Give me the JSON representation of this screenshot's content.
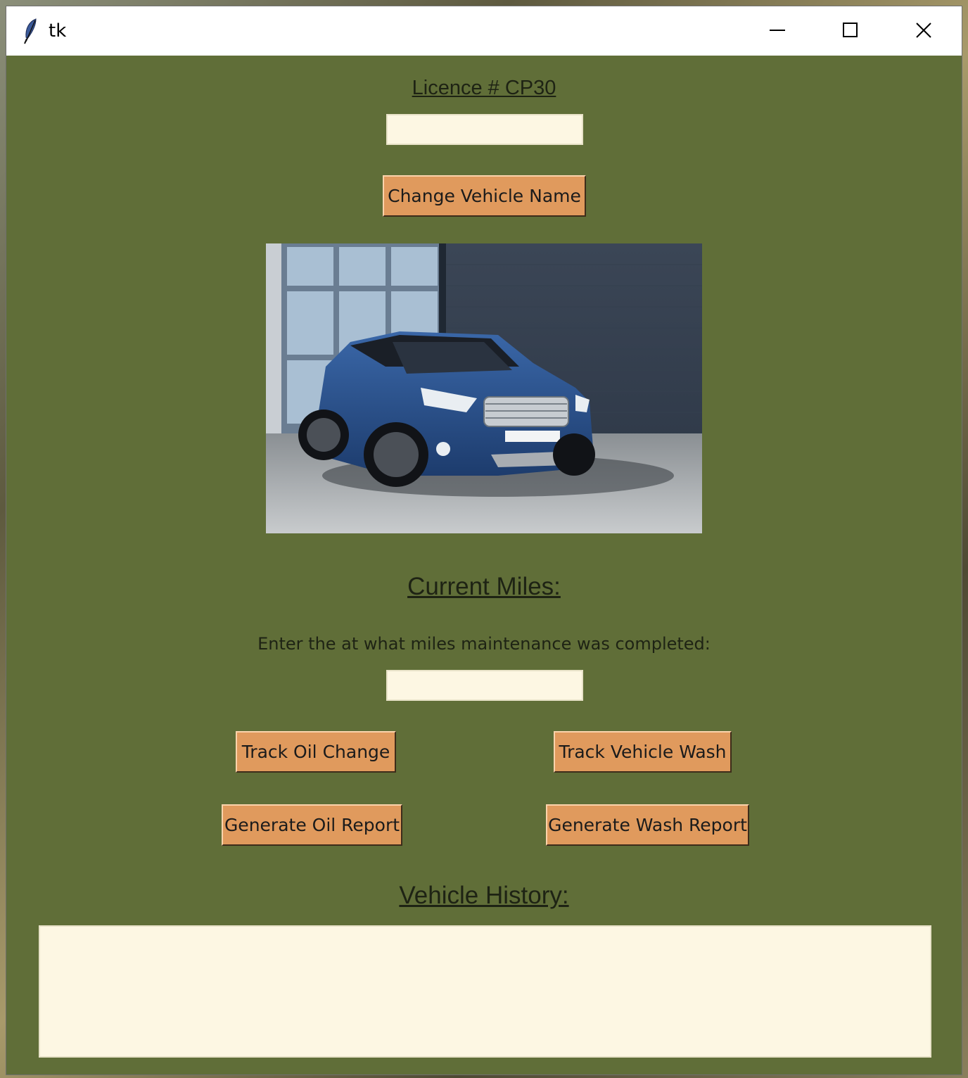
{
  "window": {
    "title": "tk"
  },
  "header": {
    "licence_label": "Licence # CP30",
    "vehicle_name_value": "",
    "change_name_button": "Change Vehicle Name"
  },
  "miles": {
    "current_miles_label": "Current Miles:",
    "prompt": "Enter the at what miles maintenance was completed:",
    "miles_value": ""
  },
  "actions": {
    "track_oil": "Track Oil Change",
    "track_wash": "Track Vehicle Wash",
    "gen_oil_report": "Generate Oil Report",
    "gen_wash_report": "Generate Wash Report"
  },
  "history": {
    "label": "Vehicle History:",
    "text": ""
  },
  "colors": {
    "background": "#606e38",
    "button": "#e09a5d",
    "entry": "#fdf7e3",
    "car_body": "#2c4f86"
  },
  "icons": {
    "app": "feather-icon",
    "minimize": "minimize-icon",
    "maximize": "maximize-icon",
    "close": "close-icon"
  }
}
